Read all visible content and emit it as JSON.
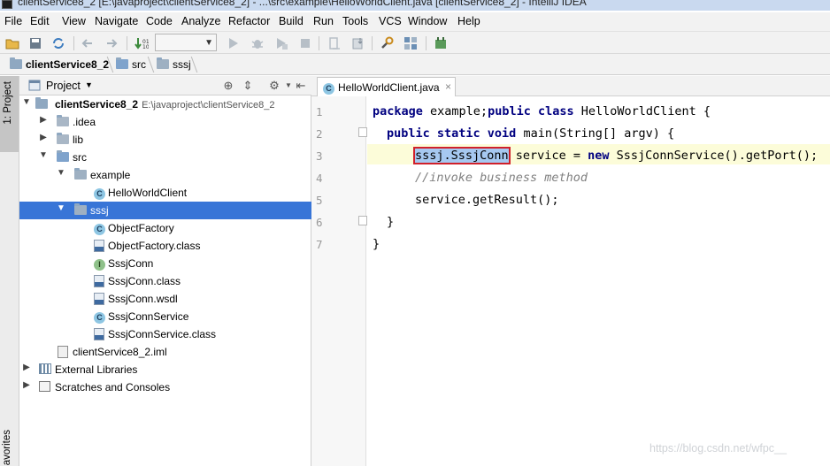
{
  "window": {
    "title": "clientService8_2 [E:\\javaproject\\clientService8_2] - ...\\src\\example\\HelloWorldClient.java [clientService8_2] - IntelliJ IDEA"
  },
  "menu": [
    "File",
    "Edit",
    "View",
    "Navigate",
    "Code",
    "Analyze",
    "Refactor",
    "Build",
    "Run",
    "Tools",
    "VCS",
    "Window",
    "Help"
  ],
  "breadcrumb": [
    "clientService8_2",
    "src",
    "sssj"
  ],
  "left_strip": {
    "project_tab": "1: Project",
    "favorites_tab": "avorites"
  },
  "project_panel": {
    "title": "Project",
    "tree": [
      {
        "label": "clientService8_2",
        "detail": "E:\\javaproject\\clientService8_2"
      },
      {
        "label": ".idea"
      },
      {
        "label": "lib"
      },
      {
        "label": "src"
      },
      {
        "label": "example"
      },
      {
        "label": "HelloWorldClient"
      },
      {
        "label": "sssj"
      },
      {
        "label": "ObjectFactory"
      },
      {
        "label": "ObjectFactory.class"
      },
      {
        "label": "SssjConn"
      },
      {
        "label": "SssjConn.class"
      },
      {
        "label": "SssjConn.wsdl"
      },
      {
        "label": "SssjConnService"
      },
      {
        "label": "SssjConnService.class"
      },
      {
        "label": "clientService8_2.iml"
      },
      {
        "label": "External Libraries"
      },
      {
        "label": "Scratches and Consoles"
      }
    ]
  },
  "editor": {
    "tab_label": "HelloWorldClient.java",
    "line_numbers": [
      "1",
      "2",
      "3",
      "4",
      "5",
      "6",
      "7"
    ],
    "code": {
      "l1_kw1": "package",
      "l1_t1": " example;",
      "l1_kw2": "public class",
      "l1_t2": " HelloWorldClient {",
      "l2_kw": "public static void",
      "l2_t": " main(String[] argv) {",
      "l3_hl": "sssj.SssjConn",
      "l3_t1": " service = ",
      "l3_kw": "new",
      "l3_t2": " SssjConnService().getPort();",
      "l4_cmt": "//invoke business method",
      "l5_t": "service.getResult();",
      "l6_t": "}",
      "l7_t": "}"
    }
  },
  "watermark": "https://blog.csdn.net/wfpc__",
  "icons": {
    "class": "C",
    "interface": "I",
    "binary": "01",
    "wsdl": "DL"
  },
  "colors": {
    "selection": "#3875d7",
    "keyword": "#000080",
    "comment": "#808080",
    "current_line": "#fcfcd9",
    "highlight_box": "#d0202a"
  }
}
